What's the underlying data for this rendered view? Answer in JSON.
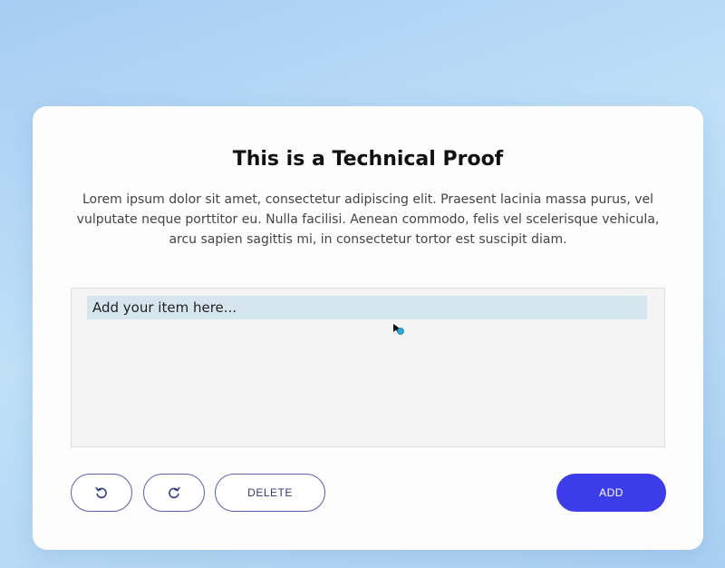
{
  "card": {
    "title": "This is a Technical Proof",
    "description": "Lorem ipsum dolor sit amet, consectetur adipiscing elit. Praesent lacinia massa purus, vel vulputate neque porttitor eu. Nulla facilisi. Aenean commodo, felis vel scelerisque vehicula, arcu sapien sagittis mi, in consectetur tortor est suscipit diam."
  },
  "list": {
    "input_placeholder": "Add your item here..."
  },
  "toolbar": {
    "undo_icon": "undo-icon",
    "redo_icon": "redo-icon",
    "delete_label": "DELETE",
    "add_label": "ADD"
  },
  "colors": {
    "accent": "#3c3de9",
    "outline": "#5a5fa8",
    "input_bg": "#d6e6ef"
  }
}
